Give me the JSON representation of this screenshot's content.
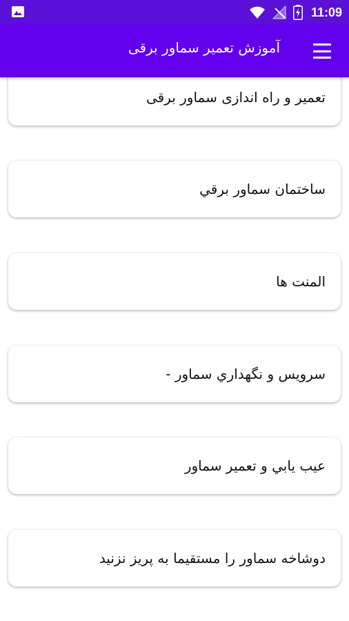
{
  "status_bar": {
    "time": "11:09",
    "icons": [
      "image-notification-icon",
      "wifi-icon",
      "no-signal-icon",
      "battery-charging-icon"
    ]
  },
  "app_bar": {
    "title": "آموزش تعمیر سماور برقی",
    "menu_icon": "hamburger-menu-icon"
  },
  "list": {
    "items": [
      {
        "label": "تعمیر و راه اندازی سماور برقی"
      },
      {
        "label": "ساختمان سماور برقي"
      },
      {
        "label": "المنت ها"
      },
      {
        "label": "سرويس و نگهداري سماور -"
      },
      {
        "label": "عيب يابي و تعمير سماور"
      },
      {
        "label": "دوشاخه سماور را مستقیما به پریز نزنید"
      }
    ]
  },
  "colors": {
    "status_bar_bg": "#5a10d6",
    "app_bar_bg": "#6200ee",
    "card_bg": "#ffffff",
    "text": "#111111"
  }
}
